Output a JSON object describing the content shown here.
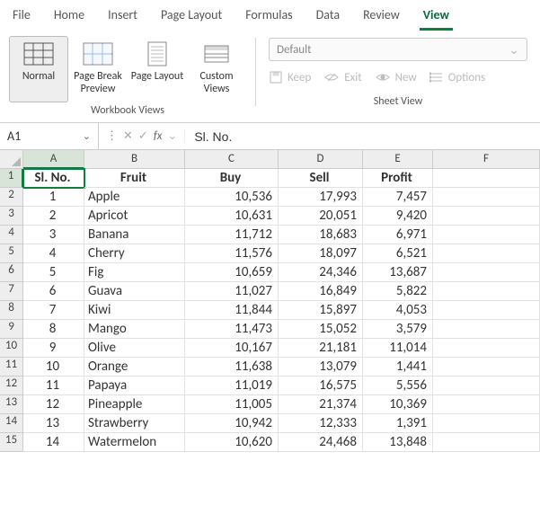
{
  "menu": {
    "items": [
      "File",
      "Home",
      "Insert",
      "Page Layout",
      "Formulas",
      "Data",
      "Review",
      "View"
    ],
    "active_index": 7
  },
  "ribbon": {
    "workbook_views": {
      "label": "Workbook Views",
      "normal": "Normal",
      "page_break": "Page Break Preview",
      "page_layout": "Page Layout",
      "custom_views": "Custom Views"
    },
    "sheet_view": {
      "label": "Sheet View",
      "dropdown": "Default",
      "keep": "Keep",
      "exit": "Exit",
      "new": "New",
      "options": "Options"
    }
  },
  "namebox": {
    "value": "A1"
  },
  "fx": {
    "label": "fx",
    "value": "Sl. No."
  },
  "columns": [
    "A",
    "B",
    "C",
    "D",
    "E",
    "F"
  ],
  "headers": {
    "A": "Sl. No.",
    "B": "Fruit",
    "C": "Buy",
    "D": "Sell",
    "E": "Profit"
  },
  "rows": [
    {
      "n": 1,
      "fruit": "Apple",
      "buy": "10,536",
      "sell": "17,993",
      "profit": "7,457"
    },
    {
      "n": 2,
      "fruit": "Apricot",
      "buy": "10,631",
      "sell": "20,051",
      "profit": "9,420"
    },
    {
      "n": 3,
      "fruit": "Banana",
      "buy": "11,712",
      "sell": "18,683",
      "profit": "6,971"
    },
    {
      "n": 4,
      "fruit": "Cherry",
      "buy": "11,576",
      "sell": "18,097",
      "profit": "6,521"
    },
    {
      "n": 5,
      "fruit": "Fig",
      "buy": "10,659",
      "sell": "24,346",
      "profit": "13,687"
    },
    {
      "n": 6,
      "fruit": "Guava",
      "buy": "11,027",
      "sell": "16,849",
      "profit": "5,822"
    },
    {
      "n": 7,
      "fruit": "Kiwi",
      "buy": "11,844",
      "sell": "15,897",
      "profit": "4,053"
    },
    {
      "n": 8,
      "fruit": "Mango",
      "buy": "11,473",
      "sell": "15,052",
      "profit": "3,579"
    },
    {
      "n": 9,
      "fruit": "Olive",
      "buy": "10,167",
      "sell": "21,181",
      "profit": "11,014"
    },
    {
      "n": 10,
      "fruit": "Orange",
      "buy": "11,638",
      "sell": "13,079",
      "profit": "1,441"
    },
    {
      "n": 11,
      "fruit": "Papaya",
      "buy": "11,019",
      "sell": "16,575",
      "profit": "5,556"
    },
    {
      "n": 12,
      "fruit": "Pineapple",
      "buy": "11,005",
      "sell": "21,374",
      "profit": "10,369"
    },
    {
      "n": 13,
      "fruit": "Strawberry",
      "buy": "10,942",
      "sell": "12,333",
      "profit": "1,391"
    },
    {
      "n": 14,
      "fruit": "Watermelon",
      "buy": "10,620",
      "sell": "24,468",
      "profit": "13,848"
    }
  ]
}
